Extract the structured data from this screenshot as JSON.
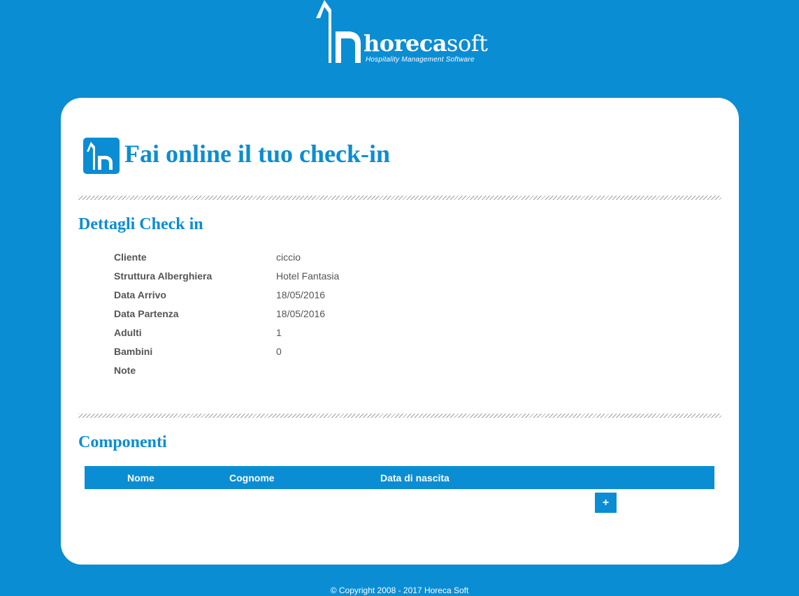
{
  "brand": {
    "logo_icon": "horecasoft-h-mark-icon",
    "name_bold": "horeca",
    "name_light": "soft",
    "tagline": "Hospitality Management Software"
  },
  "page": {
    "icon": "horecasoft-h-mark-icon",
    "title": "Fai online il tuo check-in"
  },
  "details": {
    "title": "Dettagli Check in",
    "rows": [
      {
        "label": "Cliente",
        "value": "ciccio"
      },
      {
        "label": "Struttura Alberghiera",
        "value": "Hotel Fantasia"
      },
      {
        "label": "Data Arrivo",
        "value": "18/05/2016"
      },
      {
        "label": "Data Partenza",
        "value": "18/05/2016"
      },
      {
        "label": "Adulti",
        "value": "1"
      },
      {
        "label": "Bambini",
        "value": "0"
      },
      {
        "label": "Note",
        "value": ""
      }
    ]
  },
  "components": {
    "title": "Componenti",
    "columns": [
      "Nome",
      "Cognome",
      "Data di nascita"
    ],
    "add_label": "+"
  },
  "footer": {
    "copyright": "© Copyright 2008 - 2017 Horeca Soft"
  },
  "colors": {
    "brand_blue": "#0b8dd3",
    "card_bg": "#ffffff",
    "label_text": "#555555"
  }
}
